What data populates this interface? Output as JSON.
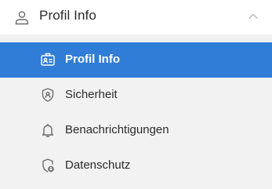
{
  "header": {
    "title": "Profil Info",
    "icon": "user-icon",
    "toggle_icon": "chevron-up-icon"
  },
  "menu": {
    "items": [
      {
        "label": "Profil Info",
        "icon": "id-card-icon",
        "active": true
      },
      {
        "label": "Sicherheit",
        "icon": "shield-icon",
        "active": false
      },
      {
        "label": "Benachrichtigungen",
        "icon": "bell-icon",
        "active": false
      },
      {
        "label": "Datenschutz",
        "icon": "shield-lock-icon",
        "active": false
      }
    ]
  },
  "colors": {
    "accent": "#2f7dd7",
    "background": "#f2f2f2",
    "header_bg": "#ffffff",
    "text": "#2b2b2b",
    "icon": "#6b6b6b"
  }
}
